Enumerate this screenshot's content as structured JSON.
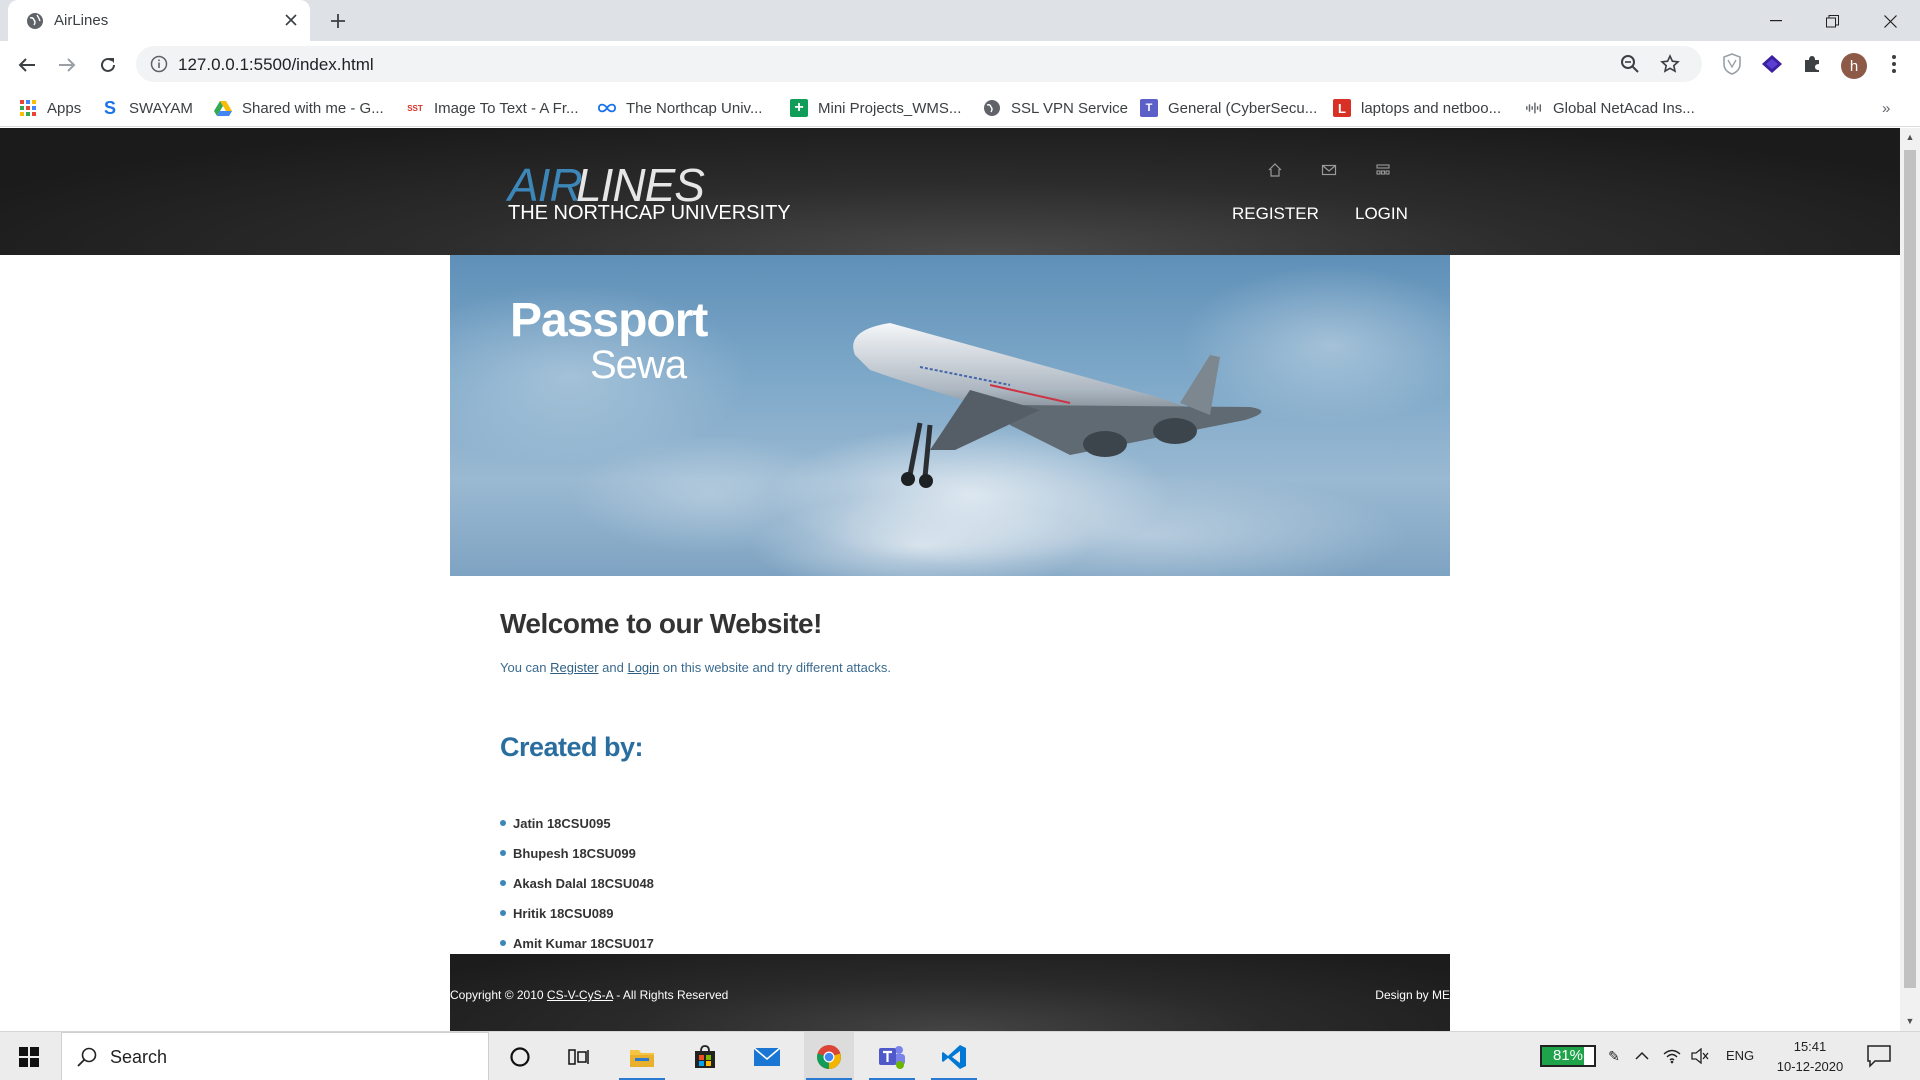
{
  "browser": {
    "tab_title": "AirLines",
    "url": "127.0.0.1:5500/index.html",
    "avatar_letter": "h"
  },
  "bookmarks": [
    {
      "label": "Apps",
      "icon": "apps-grid-icon",
      "color": "#4285f4"
    },
    {
      "label": "SWAYAM",
      "icon": "swayam-icon",
      "color": "#1a73e8"
    },
    {
      "label": "Shared with me - G...",
      "icon": "google-drive-icon",
      "color": "#34a853"
    },
    {
      "label": "Image To Text - A Fr...",
      "icon": "sst-icon",
      "color": "#d93025"
    },
    {
      "label": "The Northcap Univ...",
      "icon": "infinity-icon",
      "color": "#1a73e8"
    },
    {
      "label": "Mini Projects_WMS...",
      "icon": "plus-sheet-icon",
      "color": "#0f9d58"
    },
    {
      "label": "SSL VPN Service",
      "icon": "globe-icon",
      "color": "#5f6368"
    },
    {
      "label": "General (CyberSecu...",
      "icon": "teams-icon",
      "color": "#5b5fc7"
    },
    {
      "label": "laptops and netboo...",
      "icon": "l-icon",
      "color": "#d93025"
    },
    {
      "label": "Global NetAcad Ins...",
      "icon": "cisco-icon",
      "color": "#5f6368"
    }
  ],
  "site": {
    "logo_air": "AIR",
    "logo_lines": "LINES",
    "logo_sub": "THE NORTHCAP UNIVERSITY",
    "nav": {
      "register": "REGISTER",
      "login": "LOGIN"
    },
    "banner": {
      "title": "Passport",
      "subtitle": "Sewa"
    },
    "welcome": "Welcome to our Website!",
    "intro": {
      "before": "You can ",
      "register_link": "Register",
      "and": " and ",
      "login_link": "Login",
      "after": " on this website and try different attacks."
    },
    "created_by": "Created by:",
    "creators": [
      "Jatin 18CSU095",
      "Bhupesh 18CSU099",
      "Akash Dalal 18CSU048",
      "Hritik 18CSU089",
      "Amit Kumar 18CSU017"
    ],
    "footer": {
      "copyright": "Copyright © 2010 ",
      "link": "CS-V-CyS-A",
      "rights": " - All Rights Reserved",
      "design": "Design by ME"
    }
  },
  "taskbar": {
    "search_placeholder": "Search",
    "battery_percent": 81,
    "battery_label": "81%",
    "language": "ENG",
    "time": "15:41",
    "date": "10-12-2020"
  }
}
